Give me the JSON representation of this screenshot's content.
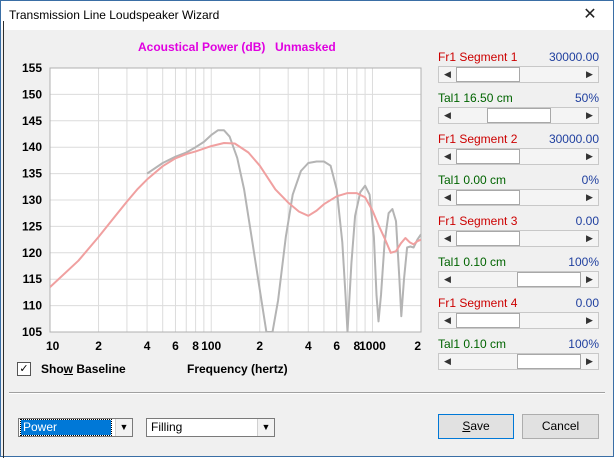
{
  "window": {
    "title": "Transmission Line Loudspeaker Wizard",
    "close_glyph": "✕"
  },
  "chart_header": {
    "title": "Acoustical Power (dB)",
    "status": "Unmasked"
  },
  "chart_data": {
    "type": "line",
    "xscale": "log",
    "xlim": [
      10,
      2000
    ],
    "ylim": [
      105,
      155
    ],
    "yticks": [
      "155",
      "150",
      "145",
      "140",
      "135",
      "130",
      "125",
      "120",
      "115",
      "110",
      "105"
    ],
    "xticks": [
      {
        "v": 10,
        "label": "10"
      },
      {
        "v": 20,
        "label": "2"
      },
      {
        "v": 40,
        "label": "4"
      },
      {
        "v": 60,
        "label": "6"
      },
      {
        "v": 80,
        "label": "8"
      },
      {
        "v": 100,
        "label": "100"
      },
      {
        "v": 200,
        "label": "2"
      },
      {
        "v": 400,
        "label": "4"
      },
      {
        "v": 600,
        "label": "6"
      },
      {
        "v": 800,
        "label": "8"
      },
      {
        "v": 1000,
        "label": "1000"
      },
      {
        "v": 2000,
        "label": "2"
      }
    ],
    "xlabel": "Frequency (hertz)",
    "series": [
      {
        "color": "#b4b4b4",
        "points": [
          [
            40,
            135.0
          ],
          [
            50,
            137.0
          ],
          [
            60,
            138.2
          ],
          [
            70,
            139.0
          ],
          [
            80,
            140.0
          ],
          [
            90,
            141.0
          ],
          [
            100,
            142.3
          ],
          [
            110,
            143.2
          ],
          [
            120,
            143.2
          ],
          [
            130,
            142.0
          ],
          [
            145,
            138.0
          ],
          [
            160,
            132.0
          ],
          [
            180,
            122.0
          ],
          [
            200,
            113.0
          ],
          [
            220,
            105.0
          ],
          [
            240,
            105.0
          ],
          [
            260,
            111.0
          ],
          [
            290,
            123.0
          ],
          [
            320,
            131.0
          ],
          [
            360,
            135.5
          ],
          [
            400,
            137.0
          ],
          [
            450,
            137.3
          ],
          [
            500,
            137.3
          ],
          [
            550,
            136.5
          ],
          [
            600,
            132.0
          ],
          [
            650,
            122.0
          ],
          [
            680,
            112.0
          ],
          [
            700,
            105.0
          ],
          [
            740,
            118.0
          ],
          [
            780,
            127.0
          ],
          [
            840,
            131.5
          ],
          [
            900,
            132.7
          ],
          [
            960,
            131.0
          ],
          [
            1020,
            123.0
          ],
          [
            1060,
            112.0
          ],
          [
            1090,
            107.0
          ],
          [
            1130,
            112.0
          ],
          [
            1190,
            122.0
          ],
          [
            1260,
            127.5
          ],
          [
            1330,
            128.3
          ],
          [
            1400,
            126.0
          ],
          [
            1470,
            115.0
          ],
          [
            1510,
            108.0
          ],
          [
            1570,
            115.0
          ],
          [
            1640,
            121.0
          ],
          [
            1720,
            121.2
          ],
          [
            1800,
            121.0
          ],
          [
            1900,
            122.5
          ],
          [
            2000,
            123.5
          ]
        ]
      },
      {
        "color": "#f0a0a0",
        "points": [
          [
            10,
            113.5
          ],
          [
            15,
            118.5
          ],
          [
            20,
            123.0
          ],
          [
            25,
            126.7
          ],
          [
            30,
            129.7
          ],
          [
            35,
            132.1
          ],
          [
            40,
            133.9
          ],
          [
            50,
            136.4
          ],
          [
            60,
            137.9
          ],
          [
            70,
            138.7
          ],
          [
            80,
            139.2
          ],
          [
            100,
            140.2
          ],
          [
            120,
            140.8
          ],
          [
            140,
            140.7
          ],
          [
            170,
            139.0
          ],
          [
            200,
            136.5
          ],
          [
            250,
            132.0
          ],
          [
            300,
            129.5
          ],
          [
            350,
            127.8
          ],
          [
            400,
            127.0
          ],
          [
            450,
            128.0
          ],
          [
            500,
            129.2
          ],
          [
            600,
            130.7
          ],
          [
            700,
            131.3
          ],
          [
            800,
            131.3
          ],
          [
            900,
            130.5
          ],
          [
            1000,
            128.0
          ],
          [
            1100,
            125.0
          ],
          [
            1200,
            122.5
          ],
          [
            1300,
            120.0
          ],
          [
            1400,
            120.3
          ],
          [
            1500,
            121.8
          ],
          [
            1600,
            122.8
          ],
          [
            1700,
            122.0
          ],
          [
            1800,
            121.6
          ],
          [
            1900,
            122.2
          ],
          [
            2000,
            122.5
          ]
        ]
      }
    ]
  },
  "show_baseline": {
    "label_pre": "Sho",
    "label_ul": "w",
    "label_post": " Baseline",
    "checked": true,
    "check_glyph": "✓"
  },
  "segments": [
    {
      "fr_label": "Fr1  Segment 1",
      "fr_value": "30000.00",
      "fr_pos": 0.0,
      "tal_label": "Tal1  16.50 cm",
      "tal_value": "50%",
      "tal_pos": 0.5
    },
    {
      "fr_label": "Fr1  Segment 2",
      "fr_value": "30000.00",
      "fr_pos": 0.0,
      "tal_label": "Tal1  0.00 cm",
      "tal_value": "0%",
      "tal_pos": 0.0
    },
    {
      "fr_label": "Fr1  Segment 3",
      "fr_value": "0.00",
      "fr_pos": 0.0,
      "tal_label": "Tal1  0.10 cm",
      "tal_value": "100%",
      "tal_pos": 1.0
    },
    {
      "fr_label": "Fr1  Segment 4",
      "fr_value": "0.00",
      "fr_pos": 0.0,
      "tal_label": "Tal1  0.10 cm",
      "tal_value": "100%",
      "tal_pos": 1.0
    }
  ],
  "scroll_arrows": {
    "left": "◀",
    "right": "▶"
  },
  "dropdowns": {
    "view": "Power",
    "material": "Filling",
    "arrow": "▼"
  },
  "buttons": {
    "save_ul": "S",
    "save_rest": "ave",
    "cancel": "Cancel"
  }
}
